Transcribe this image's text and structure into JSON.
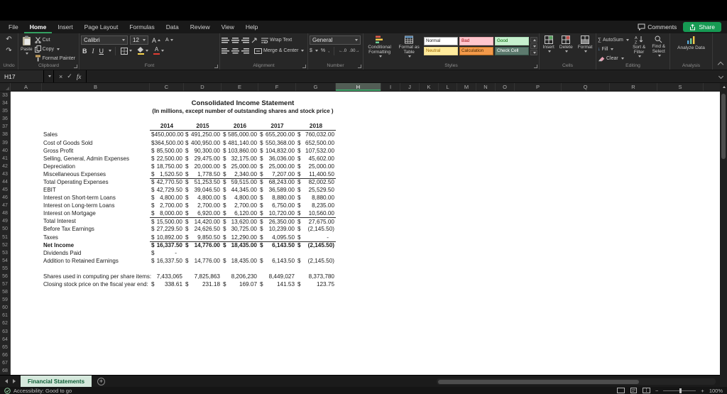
{
  "menubar": {
    "tabs": [
      {
        "label": "File",
        "active": false
      },
      {
        "label": "Home",
        "active": true
      },
      {
        "label": "Insert",
        "active": false
      },
      {
        "label": "Page Layout",
        "active": false
      },
      {
        "label": "Formulas",
        "active": false
      },
      {
        "label": "Data",
        "active": false
      },
      {
        "label": "Review",
        "active": false
      },
      {
        "label": "View",
        "active": false
      },
      {
        "label": "Help",
        "active": false
      }
    ],
    "comments_label": "Comments",
    "share_label": "Share"
  },
  "icons": {
    "undo": "↶",
    "redo": "↷",
    "bold": "B",
    "italic": "I",
    "underline": "U",
    "autosum_sigma": "∑",
    "fill_down_arrow": "↓",
    "accounting_dollar": "$",
    "percent": "%",
    "comma_style": ",",
    "increase_decimal": "←.0",
    "decrease_decimal": ".00→",
    "cancel": "×",
    "enter": "✓",
    "fx": "fx",
    "font_grow": "A",
    "font_shrink": "A",
    "font_color_letter": "A",
    "new_sheet_plus": "+",
    "zoom_out": "−",
    "zoom_in": "+"
  },
  "ribbon": {
    "undo": {
      "group_label": "Undo"
    },
    "clipboard": {
      "group_label": "Clipboard",
      "paste_label": "Paste",
      "cut_label": "Cut",
      "copy_label": "Copy",
      "format_painter_label": "Format Painter"
    },
    "font": {
      "group_label": "Font",
      "family": "Calibri",
      "size": "12"
    },
    "alignment": {
      "group_label": "Alignment",
      "wrap_label": "Wrap Text",
      "merge_label": "Merge & Center"
    },
    "number": {
      "group_label": "Number",
      "format": "General"
    },
    "styles": {
      "group_label": "Styles",
      "conditional_label": "Conditional Formatting",
      "format_table_label": "Format as Table",
      "chips": [
        {
          "label": "Normal",
          "bg": "#ffffff",
          "fg": "#1f1f1f",
          "border": "#9b9b9b"
        },
        {
          "label": "Bad",
          "bg": "#ffc7ce",
          "fg": "#9c0006",
          "border": "#e8a9b0"
        },
        {
          "label": "Good",
          "bg": "#c6efce",
          "fg": "#006100",
          "border": "#a9d9b4"
        },
        {
          "label": "Neutral",
          "bg": "#ffeb9c",
          "fg": "#9c6500",
          "border": "#e6d288"
        },
        {
          "label": "Calculation",
          "bg": "#f2994a",
          "fg": "#4a2a00",
          "border": "#b26a22"
        },
        {
          "label": "Check Cell",
          "bg": "#5d7a6e",
          "fg": "#ffffff",
          "border": "#3a5a4e"
        }
      ]
    },
    "cells": {
      "group_label": "Cells",
      "insert_label": "Insert",
      "delete_label": "Delete",
      "format_label": "Format"
    },
    "editing": {
      "group_label": "Editing",
      "autosum_label": "AutoSum",
      "fill_label": "Fill",
      "clear_label": "Clear",
      "sort_label": "Sort & Filter",
      "find_label": "Find & Select"
    },
    "analysis": {
      "group_label": "Analysis",
      "analyze_label": "Analyze Data"
    }
  },
  "formula_bar": {
    "name_box": "H17"
  },
  "sheet": {
    "column_headers": [
      "A",
      "B",
      "C",
      "D",
      "E",
      "F",
      "G",
      "H",
      "I",
      "J",
      "K",
      "L",
      "M",
      "N",
      "O",
      "P",
      "Q",
      "R",
      "S"
    ],
    "selected_column": "H",
    "row_start": 33,
    "row_end": 68,
    "title": "Consolidated Income Statement",
    "subtitle": "(In millions, except number of outstanding shares and stock price )",
    "years": [
      "2014",
      "2015",
      "2016",
      "2017",
      "2018"
    ],
    "rows": [
      {
        "r": 38,
        "label": "Sales",
        "dollar": true,
        "values": [
          "450,000.00",
          "491,250.00",
          "585,000.00",
          "655,200.00",
          "760,032.00"
        ]
      },
      {
        "r": 39,
        "label": "Cost of Goods Sold",
        "dollar": true,
        "values": [
          "364,500.00",
          "400,950.00",
          "481,140.00",
          "550,368.00",
          "652,500.00"
        ]
      },
      {
        "r": 40,
        "label": "Gross Profit",
        "dollar": true,
        "values": [
          "85,500.00",
          "90,300.00",
          "103,860.00",
          "104,832.00",
          "107,532.00"
        ]
      },
      {
        "r": 41,
        "label": "Selling, General, Admin Expenses",
        "dollar": true,
        "values": [
          "22,500.00",
          "29,475.00",
          "32,175.00",
          "36,036.00",
          "45,602.00"
        ]
      },
      {
        "r": 42,
        "label": "Depreciation",
        "dollar": true,
        "values": [
          "18,750.00",
          "20,000.00",
          "25,000.00",
          "25,000.00",
          "25,000.00"
        ]
      },
      {
        "r": 43,
        "label": "Miscellaneous Expenses",
        "dollar": true,
        "values": [
          "1,520.50",
          "1,778.50",
          "2,340.00",
          "7,207.00",
          "11,400.50"
        ]
      },
      {
        "r": 44,
        "label": "Total Operating Expenses",
        "dollar": true,
        "top": true,
        "values": [
          "42,770.50",
          "51,253.50",
          "59,515.00",
          "68,243.00",
          "82,002.50"
        ]
      },
      {
        "r": 45,
        "label": "EBIT",
        "dollar": true,
        "values": [
          "42,729.50",
          "39,046.50",
          "44,345.00",
          "36,589.00",
          "25,529.50"
        ]
      },
      {
        "r": 46,
        "label": "Interest on Short-term Loans",
        "dollar": true,
        "values": [
          "4,800.00",
          "4,800.00",
          "4,800.00",
          "8,880.00",
          "8,880.00"
        ]
      },
      {
        "r": 47,
        "label": "Interest on Long-term Loans",
        "dollar": true,
        "values": [
          "2,700.00",
          "2,700.00",
          "2,700.00",
          "6,750.00",
          "8,235.00"
        ]
      },
      {
        "r": 48,
        "label": "Interest on Mortgage",
        "dollar": true,
        "values": [
          "8,000.00",
          "6,920.00",
          "6,120.00",
          "10,720.00",
          "10,560.00"
        ]
      },
      {
        "r": 49,
        "label": "Total Interest",
        "dollar": true,
        "top": true,
        "values": [
          "15,500.00",
          "14,420.00",
          "13,620.00",
          "26,350.00",
          "27,675.00"
        ]
      },
      {
        "r": 50,
        "label": "Before Tax Earnings",
        "dollar": true,
        "values": [
          "27,229.50",
          "24,626.50",
          "30,725.00",
          "10,239.00",
          "(2,145.50)"
        ]
      },
      {
        "r": 51,
        "label": "Taxes",
        "dollar": true,
        "values": [
          "10,892.00",
          "9,850.50",
          "12,290.00",
          "4,095.50",
          "-"
        ]
      },
      {
        "r": 52,
        "label": "Net Income",
        "dollar": true,
        "bold": true,
        "top": true,
        "values": [
          "16,337.50",
          "14,776.00",
          "18,435.00",
          "6,143.50",
          "(2,145.50)"
        ]
      },
      {
        "r": 53,
        "label": "Dividends Paid",
        "dollar": true,
        "values": [
          "-",
          "",
          "",
          "",
          ""
        ]
      },
      {
        "r": 54,
        "label": "Addition to Retained Earnings",
        "dollar": true,
        "values": [
          "16,337.50",
          "14,776.00",
          "18,435.00",
          "6,143.50",
          "(2,145.50)"
        ]
      },
      {
        "r": 56,
        "label": "Shares used in computing per share items:",
        "dollar": false,
        "values": [
          "7,433,065",
          "7,825,863",
          "8,206,230",
          "8,449,027",
          "8,373,780"
        ]
      },
      {
        "r": 57,
        "label": "Closing stock price on the fiscal year end:",
        "dollar": true,
        "values": [
          "338.61",
          "231.18",
          "169.07",
          "141.53",
          "123.75"
        ]
      }
    ]
  },
  "sheet_tabs": {
    "active_tab": "Financial Statements"
  },
  "status_bar": {
    "accessibility": "Accessibility: Good to go",
    "zoom": "100%"
  }
}
